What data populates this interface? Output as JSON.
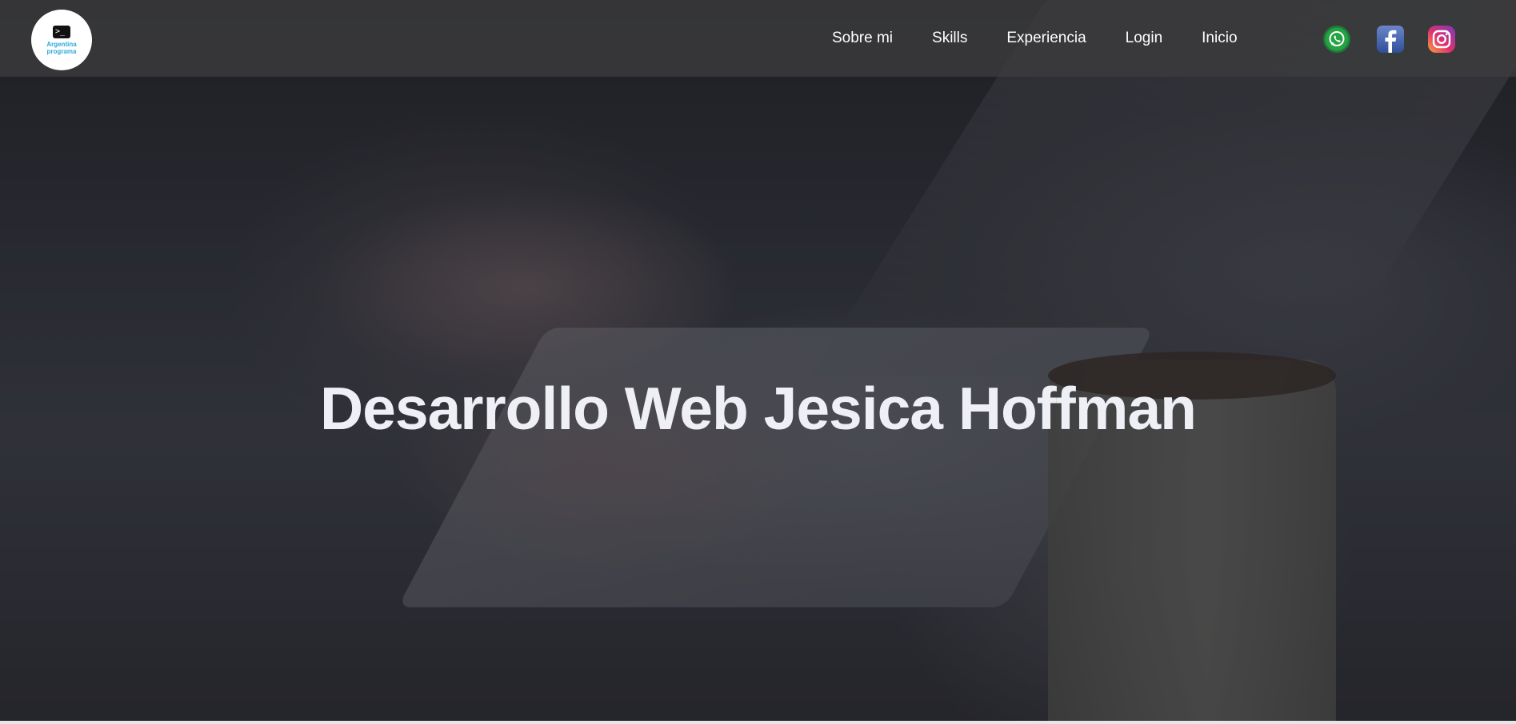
{
  "header": {
    "logo": {
      "line1": "Argentina",
      "line2": "programa",
      "prompt": ">_"
    },
    "nav": [
      {
        "label": "Sobre mi"
      },
      {
        "label": "Skills"
      },
      {
        "label": "Experiencia"
      },
      {
        "label": "Login"
      },
      {
        "label": "Inicio"
      }
    ],
    "social": [
      {
        "icon": "whatsapp-icon",
        "color": "#25a244"
      },
      {
        "icon": "facebook-icon",
        "color": "#3b5bab"
      },
      {
        "icon": "instagram-icon",
        "color": "#c13584"
      }
    ]
  },
  "hero": {
    "title": "Desarrollo Web Jesica Hoffman"
  }
}
